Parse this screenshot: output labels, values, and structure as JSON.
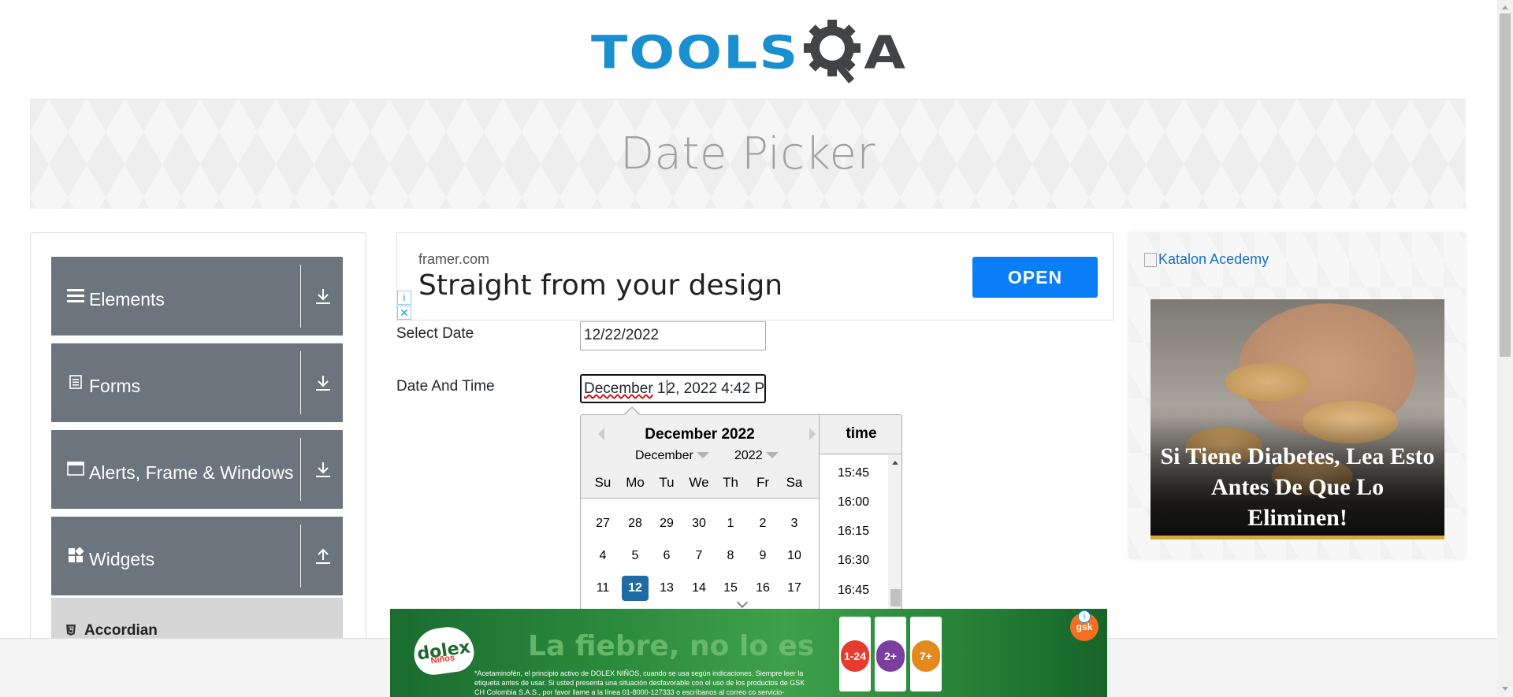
{
  "header": {
    "logo_text_1": "TOOLS",
    "logo_text_2": "A",
    "page_title": "Date Picker",
    "colors": {
      "logo_blue": "#1a8fcf",
      "logo_dark": "#424345",
      "nav_bg": "#6c757d",
      "selected_day": "#216ba5",
      "open_button": "#0a7ef6"
    }
  },
  "sidebar": {
    "groups": [
      {
        "label": "Elements",
        "icon": "hamburger-icon",
        "arrow": "download-arrow-icon"
      },
      {
        "label": "Forms",
        "icon": "form-icon",
        "arrow": "download-arrow-icon"
      },
      {
        "label": "Alerts, Frame & Windows",
        "icon": "window-icon",
        "arrow": "download-arrow-icon"
      },
      {
        "label": "Widgets",
        "icon": "widgets-icon",
        "arrow": "upload-arrow-icon"
      }
    ],
    "active_item": {
      "label": "Accordian",
      "icon": "html5-icon"
    }
  },
  "ad_top": {
    "source": "framer.com",
    "headline": "Straight from your design",
    "button": "OPEN",
    "info": "i",
    "close": "✕"
  },
  "form": {
    "select_date_label": "Select Date",
    "select_date_value": "12/22/2022",
    "date_time_label": "Date And Time",
    "date_time_value_part1": "December",
    "date_time_value_part2": " 1",
    "date_time_value_part3": "2, 2022 4:42 P"
  },
  "picker": {
    "title": "December 2022",
    "month_select": "December",
    "year_select": "2022",
    "weekdays": [
      "Su",
      "Mo",
      "Tu",
      "We",
      "Th",
      "Fr",
      "Sa"
    ],
    "weeks": [
      [
        "27",
        "28",
        "29",
        "30",
        "1",
        "2",
        "3"
      ],
      [
        "4",
        "5",
        "6",
        "7",
        "8",
        "9",
        "10"
      ],
      [
        "11",
        "12",
        "13",
        "14",
        "15",
        "16",
        "17"
      ]
    ],
    "selected_day": "12",
    "time_header": "time",
    "times": [
      "15:45",
      "16:00",
      "16:15",
      "16:30",
      "16:45"
    ]
  },
  "ad_right": {
    "broken_image_alt": "Katalon Acedemy",
    "caption": "Si Tiene Diabetes, Lea Esto Antes De Que Lo Eliminen!"
  },
  "ad_bottom": {
    "brand": "dolex",
    "brand_sub": "Niños",
    "tagline": "La fiebre, no lo es",
    "fine_print": "*Acetaminofén, el principio activo de DOLEX NIÑOS, cuando se usa según indicaciones. Siempre leer la etiqueta antes de usar. Si usted presenta una situación desfavorable con el uso de los productos de GSK CH Colombia S.A.S., por favor llame a la línea 01-8000-127333 o escríbanos al correo co.servicio-cliente@gsk.com",
    "pack_labels": [
      "1-24",
      "2+",
      "7+"
    ],
    "sponsor": "gsk",
    "info": "i"
  }
}
